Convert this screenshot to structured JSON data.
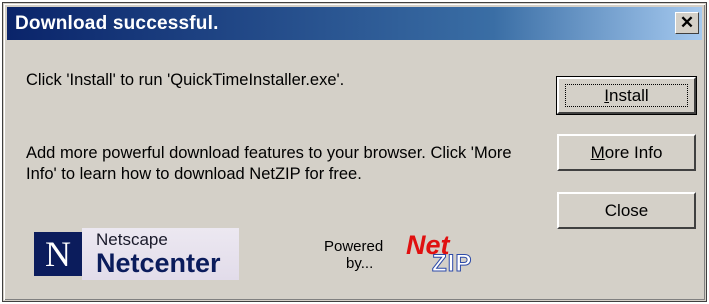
{
  "window": {
    "title": "Download successful."
  },
  "title_bar": {
    "close_glyph": "✕"
  },
  "message": {
    "line1": "Click 'Install' to run 'QuickTimeInstaller.exe'.",
    "line2": "Add more powerful download features to your browser. Click 'More Info' to learn how to download NetZIP for free."
  },
  "buttons": {
    "install": {
      "label_prefix": "",
      "label_accel": "I",
      "label_rest": "nstall"
    },
    "more_info": {
      "label_prefix": "",
      "label_accel": "M",
      "label_rest": "ore Info"
    },
    "close": {
      "label": "Close"
    }
  },
  "netscape_logo": {
    "mark": "N",
    "line1": "Netscape",
    "line2": "Netcenter"
  },
  "powered_logo": {
    "line1": "Powered",
    "line2": "by...",
    "brand_net": "Net",
    "brand_zip": "ZIP"
  },
  "colors": {
    "title_gradient_start": "#0a246a",
    "title_gradient_end": "#a6caf0",
    "dialog_face": "#d4d0c8"
  }
}
